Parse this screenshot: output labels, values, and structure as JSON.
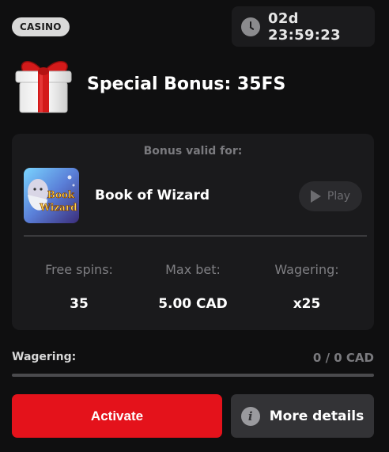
{
  "badge": {
    "label": "CASINO"
  },
  "timer": {
    "icon": "clock-icon",
    "value": "02d 23:59:23"
  },
  "bonus": {
    "icon": "gift-icon",
    "title": "Special Bonus: 35FS"
  },
  "valid_for": {
    "heading": "Bonus valid for:",
    "game": {
      "name": "Book of Wizard",
      "thumb_text_1": "Book",
      "thumb_text_2": "Wizard",
      "play_label": "Play"
    }
  },
  "stats": [
    {
      "label": "Free spins:",
      "value": "35"
    },
    {
      "label": "Max bet:",
      "value": "5.00 CAD"
    },
    {
      "label": "Wagering:",
      "value": "x25"
    }
  ],
  "wagering": {
    "label": "Wagering:",
    "value": "0 / 0 CAD",
    "progress_percent": 0
  },
  "actions": {
    "activate_label": "Activate",
    "details_label": "More details",
    "details_icon": "info-icon"
  },
  "colors": {
    "accent": "#e4121b",
    "background": "#0f0f10",
    "panel": "#1a1a1c"
  }
}
